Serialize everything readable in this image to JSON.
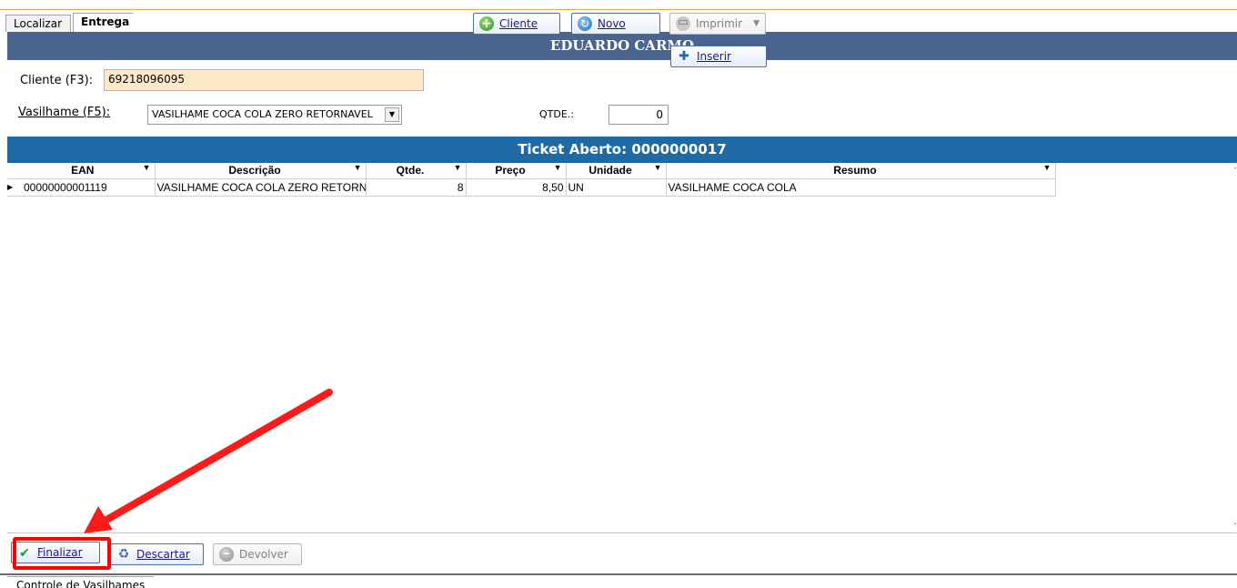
{
  "tabs": [
    {
      "label": "Localizar",
      "active": false
    },
    {
      "label": "Entrega",
      "active": true
    }
  ],
  "header": {
    "customer_name": "EDUARDO CARMO"
  },
  "form": {
    "cliente_label": "Cliente (F3):",
    "cliente_value": "69218096095",
    "vasilhame_label": "Vasilhame (F5):",
    "vasilhame_value": "VASILHAME COCA COLA ZERO RETORNAVEL",
    "qtde_label": "QTDE.:",
    "qtde_value": "0"
  },
  "buttons": {
    "cliente": "Cliente",
    "novo": "Novo",
    "imprimir": "Imprimir",
    "inserir": "Inserir",
    "finalizar": "Finalizar",
    "descartar": "Descartar",
    "devolver": "Devolver"
  },
  "ticket": {
    "title": "Ticket Aberto: 0000000017"
  },
  "grid": {
    "columns": [
      "EAN",
      "Descrição",
      "Qtde.",
      "Preço",
      "Unidade",
      "Resumo"
    ],
    "rows": [
      {
        "ean": "00000000001119",
        "descricao": "VASILHAME COCA COLA ZERO RETORNAVEL",
        "qtde": "8",
        "preco": "8,50",
        "unidade": "UN",
        "resumo": "VASILHAME COCA COLA"
      }
    ]
  },
  "status_tab": "Controle de Vasilhames",
  "colors": {
    "header": "#4a6490",
    "ticket_bar": "#1f6aa5",
    "highlight": "#ff0000",
    "cliente_input": "#fde8c8"
  }
}
